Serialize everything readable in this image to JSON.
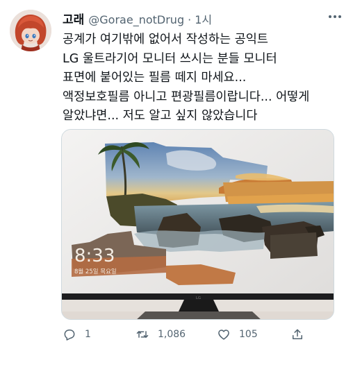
{
  "tweet": {
    "author": {
      "name": "고래",
      "handle": "@Gorae_notDrug",
      "separator": "·",
      "time": "1시"
    },
    "lines": [
      "공계가 여기밖에 없어서 작성하는 공익트",
      "LG 울트라기어 모니터 쓰시는 분들 모니터",
      "표면에 붙어있는 필름 떼지 마세요...",
      "액정보호필름 아니고 편광필름이랍니다... 어떻게",
      "알았냐면... 저도 알고 싶지 않았습니다"
    ],
    "media": {
      "clock_time": "8:33",
      "clock_date": "8월 25일 목요일",
      "brand": "LG"
    },
    "actions": {
      "reply_count": "1",
      "retweet_count": "1,086",
      "like_count": "105"
    }
  },
  "colors": {
    "text": "#0f1419",
    "secondary": "#536471",
    "border": "#cfd9de"
  },
  "icons": [
    "avatar-image",
    "more-icon",
    "reply-icon",
    "retweet-icon",
    "like-icon",
    "share-icon"
  ]
}
